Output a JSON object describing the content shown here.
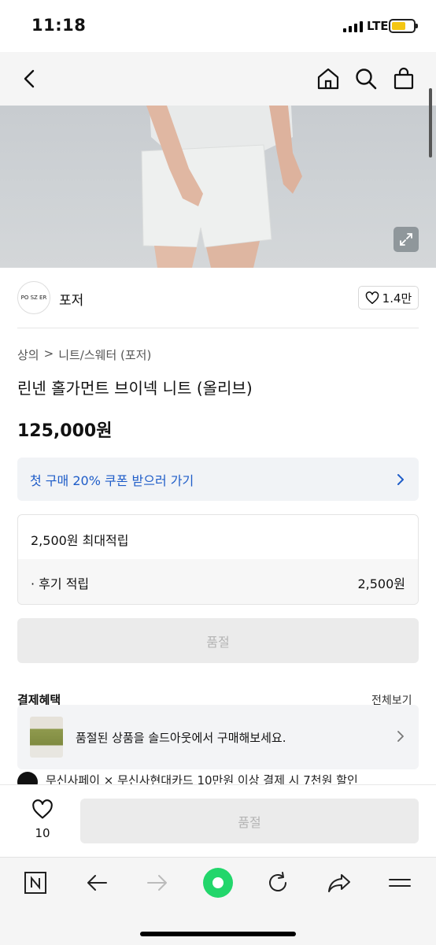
{
  "status": {
    "time": "11:18",
    "network": "LTE"
  },
  "brand": {
    "logo_text": "PO SZ ER",
    "name": "포저",
    "likes": "1.4만"
  },
  "breadcrumb": {
    "category": "상의",
    "separator": ">",
    "subcategory": "니트/스웨터 (포저)"
  },
  "product": {
    "title": "린넨 홀가먼트 브이넥 니트 (올리브)",
    "price": "125,000원"
  },
  "coupon": {
    "label": "첫 구매 20% 쿠폰 받으러 가기"
  },
  "points": {
    "max_label": "2,500원 최대적립",
    "review_label": "· 후기 적립",
    "review_value": "2,500원"
  },
  "soldout_label": "품절",
  "benefits": {
    "title": "결제혜택",
    "more": "전체보기",
    "banner_text": "품절된 상품을 솔드아웃에서 구매해보세요.",
    "pay_text": "무신사페이 × 무신사현대카드 10만원 이상 결제 시 7천원 할인"
  },
  "bottom_bar": {
    "wish_count": "10",
    "buy_label": "품절"
  },
  "colors": {
    "coupon_text": "#1e5cc8",
    "battery": "#f4c612",
    "reload_green": "#22d66b"
  },
  "icons": [
    "back-icon",
    "home-icon",
    "search-icon",
    "bag-icon",
    "expand-icon",
    "heart-icon",
    "chevron-right-icon",
    "naver-icon",
    "arrow-left-icon",
    "arrow-right-icon",
    "green-dot-icon",
    "reload-icon",
    "share-icon",
    "menu-icon"
  ]
}
